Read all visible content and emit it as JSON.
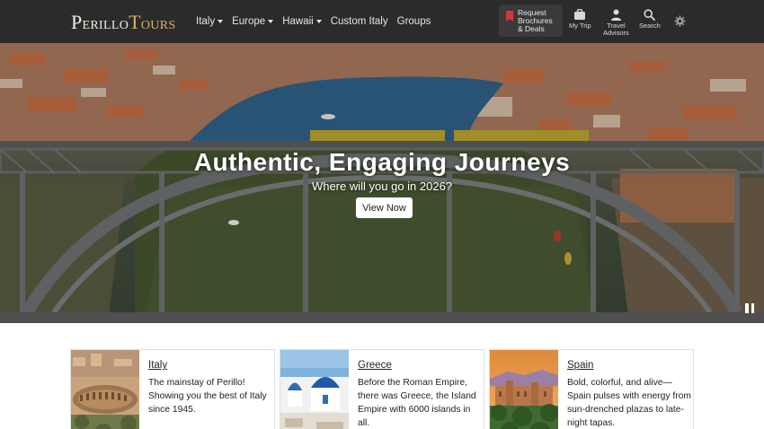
{
  "brand": {
    "name_part1": "Perillo",
    "name_part2": "Tours"
  },
  "nav": {
    "links": [
      {
        "label": "Italy",
        "dropdown": true
      },
      {
        "label": "Europe",
        "dropdown": true
      },
      {
        "label": "Hawaii",
        "dropdown": true
      },
      {
        "label": "Custom Italy",
        "dropdown": false
      },
      {
        "label": "Groups",
        "dropdown": false
      }
    ],
    "request_brochures": {
      "line1": "Request",
      "line2": "Brochures",
      "line3": "& Deals",
      "icon": "bookmark-icon"
    },
    "my_trip": {
      "label": "My Trip",
      "icon": "briefcase-icon"
    },
    "travel_advisors": {
      "line1": "Travel",
      "line2": "Advisors",
      "icon": "person-icon"
    },
    "search": {
      "label": "Search",
      "icon": "search-icon"
    },
    "settings": {
      "icon": "gear-icon"
    }
  },
  "hero": {
    "title": "Authentic, Engaging Journeys",
    "subtitle": "Where will you go in 2026?",
    "cta_label": "View Now",
    "pause_icon": "pause-icon"
  },
  "cards": [
    {
      "title": "Italy",
      "description": "The mainstay of Perillo! Showing you the best of Italy since 1945."
    },
    {
      "title": "Greece",
      "description": "Before the Roman Empire, there was Greece, the Island Empire with 6000 islands in all."
    },
    {
      "title": "Spain",
      "description": "Bold, colorful, and alive—Spain pulses with energy from sun-drenched plazas to late-night tapas."
    }
  ],
  "colors": {
    "navbar_bg": "#2b2b2b",
    "brand_accent": "#d6b26a",
    "bookmark_red": "#d03a3a",
    "river_blue": "#2f5f86"
  }
}
